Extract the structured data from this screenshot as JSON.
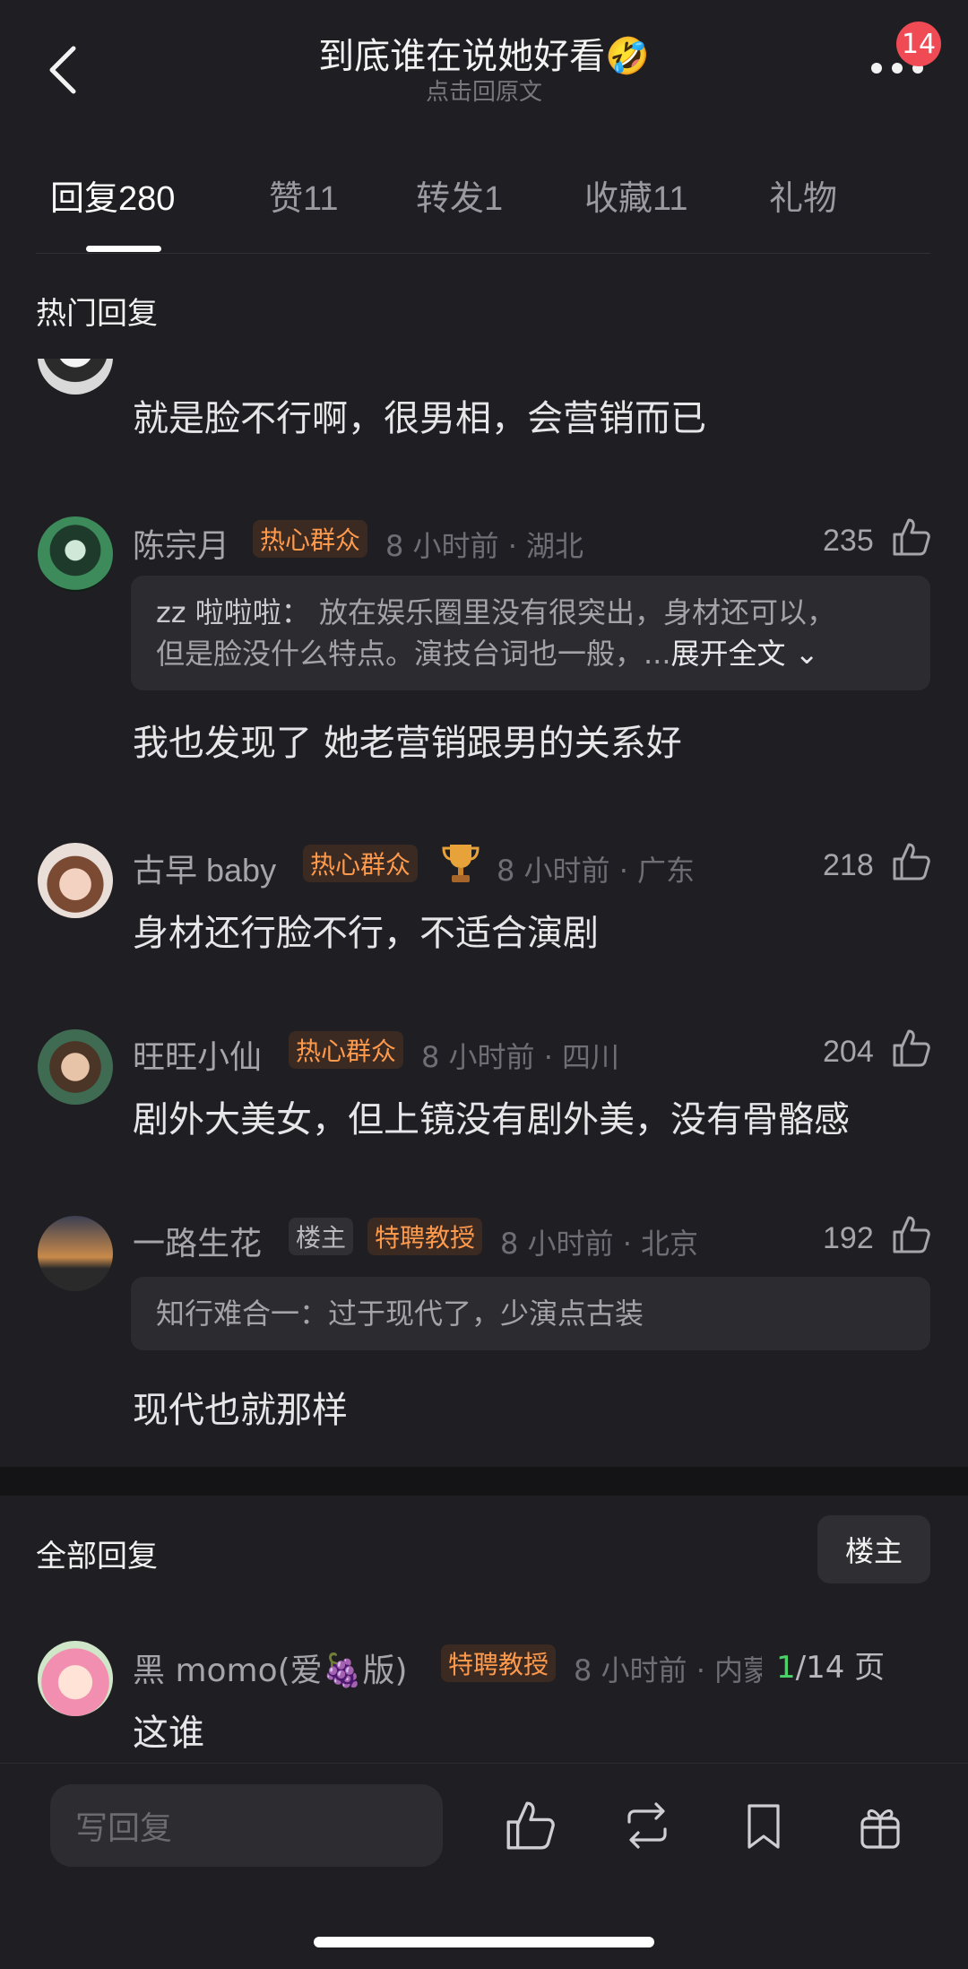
{
  "header": {
    "title": "到底谁在说她好看🤣",
    "subtitle": "点击回原文",
    "notification_count": "14"
  },
  "tabs": [
    {
      "label": "回复",
      "count": "280"
    },
    {
      "label": "赞",
      "count": "11"
    },
    {
      "label": "转发",
      "count": "1"
    },
    {
      "label": "收藏",
      "count": "11"
    },
    {
      "label": "礼物",
      "count": ""
    }
  ],
  "hot": {
    "title": "热门回复",
    "partial_comment": {
      "text": "就是脸不行啊，很男相，会营销而已"
    },
    "comments": [
      {
        "name": "陈宗月",
        "tags": [
          "热心群众"
        ],
        "meta": "8 小时前 · 湖北",
        "likes": "235",
        "quote_author": "zz 啦啦啦：",
        "quote_text_1": "放在娱乐圈里没有很突出，身材还可以，",
        "quote_text_2": "但是脸没什么特点。演技台词也一般，...",
        "quote_expand": "展开全文",
        "text": "我也发现了 她老营销跟男的关系好"
      },
      {
        "name": "古早 baby",
        "tags": [
          "热心群众"
        ],
        "meta": "8 小时前 · 广东",
        "likes": "218",
        "text": "身材还行脸不行，不适合演剧"
      },
      {
        "name": "旺旺小仙",
        "tags": [
          "热心群众"
        ],
        "meta": "8 小时前 · 四川",
        "likes": "204",
        "text": "剧外大美女，但上镜没有剧外美，没有骨骼感"
      },
      {
        "name": "一路生花",
        "tags": [
          "楼主",
          "特聘教授"
        ],
        "meta": "8 小时前 · 北京",
        "likes": "192",
        "quote_text": "知行难合一：过于现代了，少演点古装",
        "text": "现代也就那样"
      }
    ]
  },
  "all": {
    "title": "全部回复",
    "owner_button": "楼主",
    "comment": {
      "name": "黑 momo(爱🍇版)",
      "tags": [
        "特聘教授"
      ],
      "meta": "8 小时前 · 内蒙",
      "text": "这谁"
    },
    "page_current": "1",
    "page_total": "/14 页"
  },
  "bottom": {
    "reply_placeholder": "写回复"
  },
  "colors": {
    "background": "#1f1f23",
    "tag_orange": "#ff9a4d",
    "badge_red": "#f04a55",
    "page_green": "#4cd26a"
  },
  "icons": [
    "back-arrow-icon",
    "more-dots-icon",
    "thumbs-up-icon",
    "repost-icon",
    "bookmark-icon",
    "gift-icon",
    "trophy-icon"
  ]
}
